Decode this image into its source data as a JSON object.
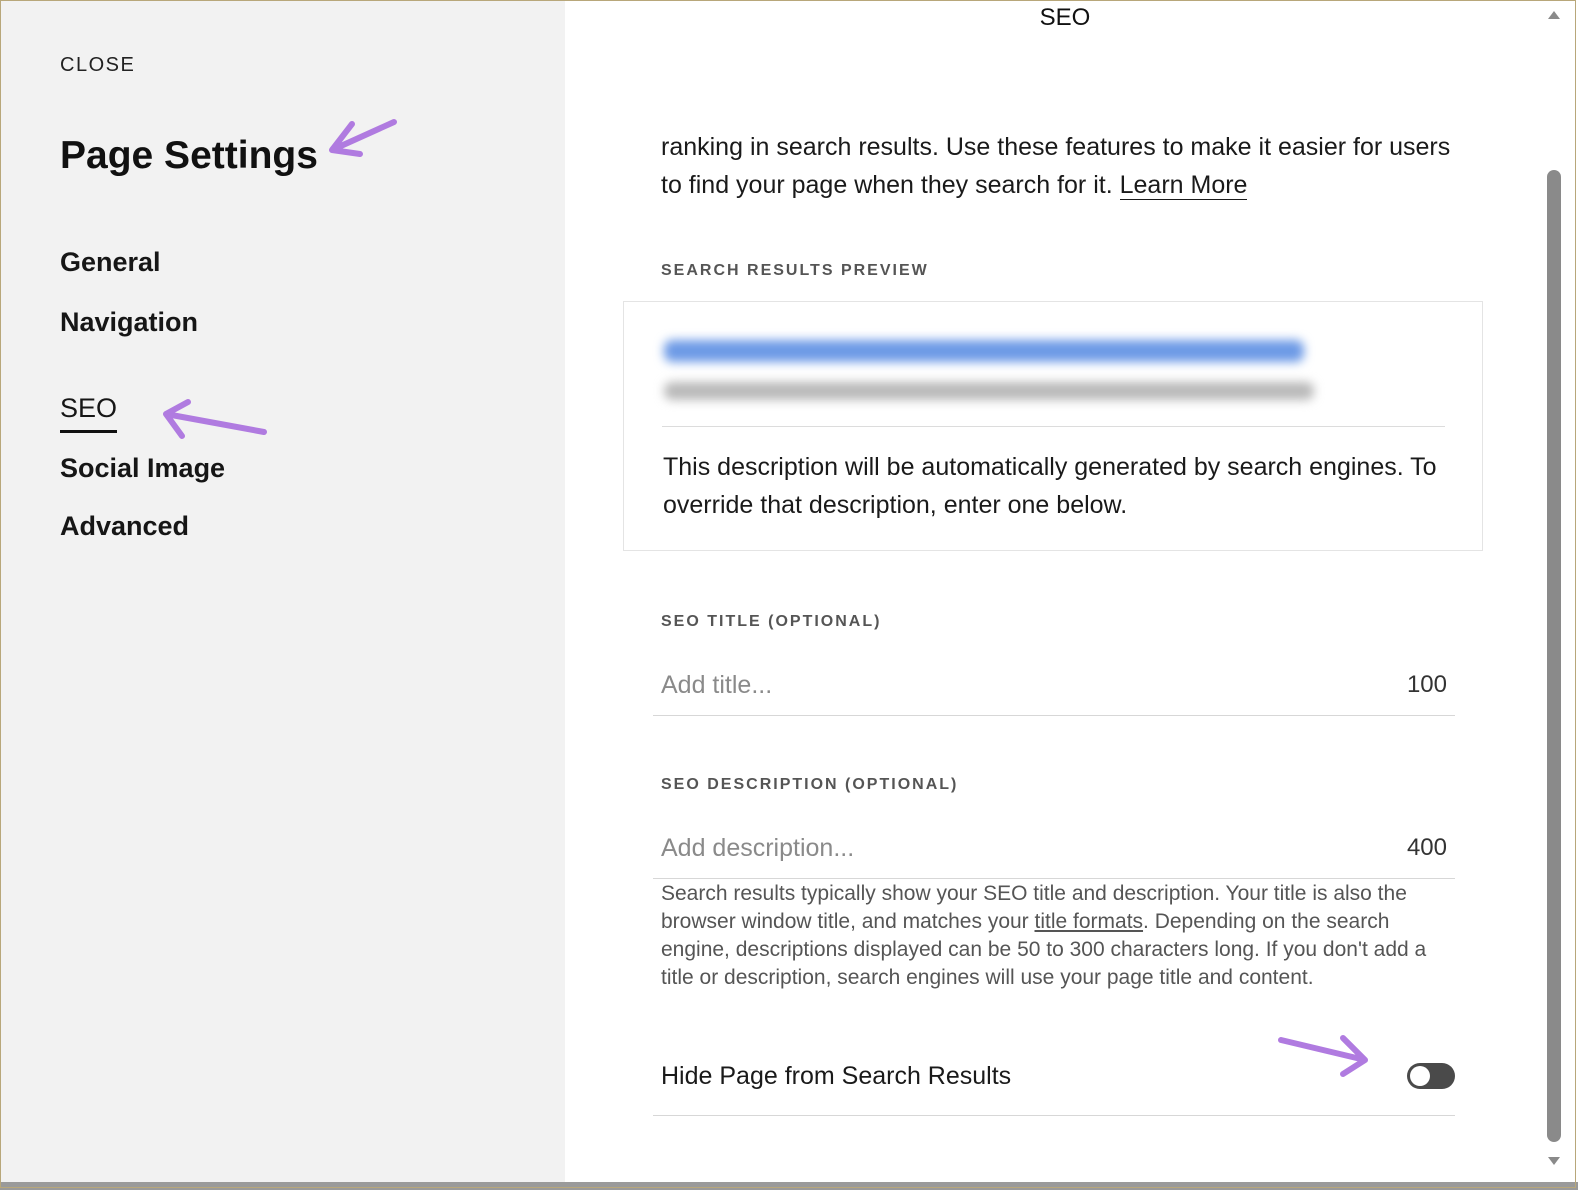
{
  "sidebar": {
    "close_label": "CLOSE",
    "title": "Page Settings",
    "items": [
      {
        "label": "General"
      },
      {
        "label": "Navigation"
      },
      {
        "label": "SEO"
      },
      {
        "label": "Social Image"
      },
      {
        "label": "Advanced"
      }
    ],
    "active_item": "SEO"
  },
  "panel": {
    "title": "SEO",
    "intro_text": "ranking in search results. Use these features to make it easier for users to find your page when they search for it.",
    "learn_more": "Learn More",
    "preview": {
      "label": "SEARCH RESULTS PREVIEW",
      "description": "This description will be automatically generated by search engines. To override that description, enter one below."
    },
    "seo_title": {
      "label": "SEO TITLE (OPTIONAL)",
      "placeholder": "Add title...",
      "count": "100"
    },
    "seo_description": {
      "label": "SEO DESCRIPTION (OPTIONAL)",
      "placeholder": "Add description...",
      "count": "400"
    },
    "help": {
      "part1": "Search results typically show your SEO title and description. Your title is also the browser window title, and matches your ",
      "link": "title formats",
      "part2": ". Depending on the search engine, descriptions displayed can be 50 to 300 characters long. If you don't add a title or description, search engines will use your page title and content."
    },
    "hide_page": {
      "label": "Hide Page from Search Results",
      "enabled": false
    }
  },
  "colors": {
    "sidebar_bg": "#f2f2f2",
    "annotation_arrow": "#b07be0",
    "toggle_off": "#4a4a4a",
    "preview_link_blur": "#4a7fe0"
  }
}
